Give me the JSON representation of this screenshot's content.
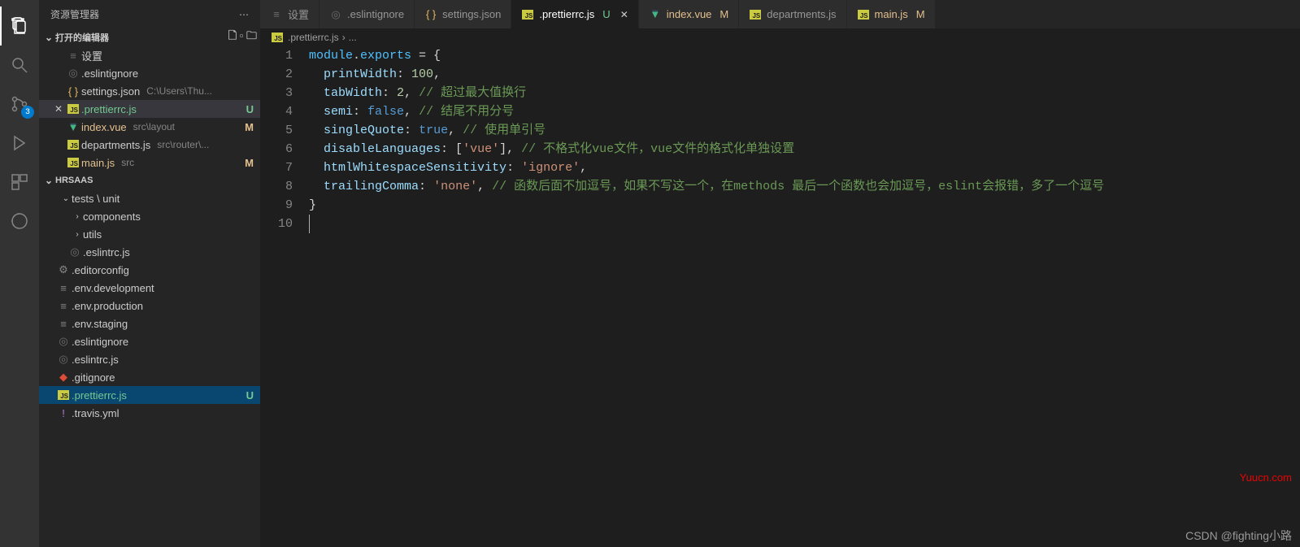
{
  "sidebar": {
    "title": "资源管理器",
    "openEditors": {
      "title": "打开的编辑器",
      "items": [
        {
          "icon": "settings",
          "name": "设置",
          "hint": "",
          "status": ""
        },
        {
          "icon": "circle",
          "name": ".eslintignore",
          "hint": "",
          "status": ""
        },
        {
          "icon": "braces",
          "name": "settings.json",
          "hint": "C:\\Users\\Thu...",
          "status": ""
        },
        {
          "icon": "js",
          "name": ".prettierrc.js",
          "hint": "",
          "status": "U",
          "statusClass": "git-u",
          "active": true,
          "closable": true
        },
        {
          "icon": "vue",
          "name": "index.vue",
          "hint": "src\\layout",
          "status": "M",
          "statusClass": "git-m"
        },
        {
          "icon": "js",
          "name": "departments.js",
          "hint": "src\\router\\...",
          "status": ""
        },
        {
          "icon": "js",
          "name": "main.js",
          "hint": "src",
          "status": "M",
          "statusClass": "git-m"
        }
      ]
    },
    "workspace": {
      "title": "HRSAAS",
      "folders": [
        {
          "name": "tests \\ unit",
          "depth": 1,
          "open": true
        },
        {
          "name": "components",
          "depth": 2,
          "open": false
        },
        {
          "name": "utils",
          "depth": 2,
          "open": false
        }
      ],
      "files": [
        {
          "icon": "circle",
          "name": ".eslintrc.js",
          "depth": 1
        },
        {
          "icon": "gear",
          "name": ".editorconfig",
          "depth": 0
        },
        {
          "icon": "file",
          "name": ".env.development",
          "depth": 0
        },
        {
          "icon": "file",
          "name": ".env.production",
          "depth": 0
        },
        {
          "icon": "file",
          "name": ".env.staging",
          "depth": 0
        },
        {
          "icon": "circle",
          "name": ".eslintignore",
          "depth": 0
        },
        {
          "icon": "circle",
          "name": ".eslintrc.js",
          "depth": 0
        },
        {
          "icon": "git",
          "name": ".gitignore",
          "depth": 0
        },
        {
          "icon": "js",
          "name": ".prettierrc.js",
          "depth": 0,
          "status": "U",
          "statusClass": "git-u",
          "activeStrong": true
        },
        {
          "icon": "bang",
          "name": ".travis.yml",
          "depth": 0
        }
      ]
    }
  },
  "activityBadge": "3",
  "tabs": [
    {
      "icon": "settings",
      "label": "设置"
    },
    {
      "icon": "circle",
      "label": ".eslintignore"
    },
    {
      "icon": "braces",
      "label": "settings.json"
    },
    {
      "icon": "js",
      "label": ".prettierrc.js",
      "status": "U",
      "statusClass": "git-u",
      "active": true,
      "closable": true
    },
    {
      "icon": "vue",
      "label": "index.vue",
      "status": "M",
      "statusClass": "git-m"
    },
    {
      "icon": "js",
      "label": "departments.js"
    },
    {
      "icon": "js",
      "label": "main.js",
      "status": "M",
      "statusClass": "git-m"
    }
  ],
  "breadcrumb": {
    "file": ".prettierrc.js",
    "rest": "..."
  },
  "code": {
    "lines": [
      {
        "n": 1,
        "tokens": [
          [
            "id",
            "module"
          ],
          [
            "punc",
            "."
          ],
          [
            "id",
            "exports"
          ],
          [
            "punc",
            " = {"
          ]
        ]
      },
      {
        "n": 2,
        "tokens": [
          [
            "punc",
            "  "
          ],
          [
            "prop",
            "printWidth"
          ],
          [
            "punc",
            ": "
          ],
          [
            "num",
            "100"
          ],
          [
            "punc",
            ","
          ]
        ]
      },
      {
        "n": 3,
        "tokens": [
          [
            "punc",
            "  "
          ],
          [
            "prop",
            "tabWidth"
          ],
          [
            "punc",
            ": "
          ],
          [
            "num",
            "2"
          ],
          [
            "punc",
            ", "
          ],
          [
            "comment",
            "// 超过最大值换行"
          ]
        ]
      },
      {
        "n": 4,
        "tokens": [
          [
            "punc",
            "  "
          ],
          [
            "prop",
            "semi"
          ],
          [
            "punc",
            ": "
          ],
          [
            "bool",
            "false"
          ],
          [
            "punc",
            ", "
          ],
          [
            "comment",
            "// 结尾不用分号"
          ]
        ]
      },
      {
        "n": 5,
        "tokens": [
          [
            "punc",
            "  "
          ],
          [
            "prop",
            "singleQuote"
          ],
          [
            "punc",
            ": "
          ],
          [
            "bool",
            "true"
          ],
          [
            "punc",
            ", "
          ],
          [
            "comment",
            "// 使用单引号"
          ]
        ]
      },
      {
        "n": 6,
        "tokens": [
          [
            "punc",
            "  "
          ],
          [
            "prop",
            "disableLanguages"
          ],
          [
            "punc",
            ": ["
          ],
          [
            "str",
            "'vue'"
          ],
          [
            "punc",
            "], "
          ],
          [
            "comment",
            "// 不格式化vue文件，vue文件的格式化单独设置"
          ]
        ]
      },
      {
        "n": 7,
        "tokens": [
          [
            "punc",
            "  "
          ],
          [
            "prop",
            "htmlWhitespaceSensitivity"
          ],
          [
            "punc",
            ": "
          ],
          [
            "str",
            "'ignore'"
          ],
          [
            "punc",
            ","
          ]
        ]
      },
      {
        "n": 8,
        "tokens": [
          [
            "punc",
            "  "
          ],
          [
            "prop",
            "trailingComma"
          ],
          [
            "punc",
            ": "
          ],
          [
            "str",
            "'none'"
          ],
          [
            "punc",
            ", "
          ],
          [
            "comment",
            "// 函数后面不加逗号，如果不写这一个，在methods 最后一个函数也会加逗号，eslint会报错，多了一个逗号"
          ]
        ]
      },
      {
        "n": 9,
        "tokens": [
          [
            "punc",
            "}"
          ]
        ]
      },
      {
        "n": 10,
        "tokens": [],
        "cursor": true
      }
    ]
  },
  "watermark": {
    "top": "Yuucn.com",
    "bottom": "CSDN @fighting小路"
  }
}
